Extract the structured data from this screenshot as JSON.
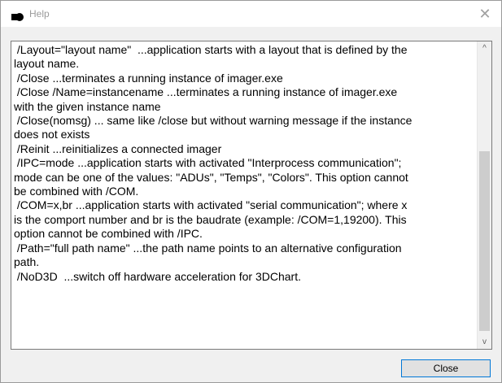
{
  "window": {
    "title": "Help",
    "title_icon": "app-icon",
    "close_glyph": "✕"
  },
  "help_text": {
    "lines": [
      " /Layout=\"layout name\"  ...application starts with a layout that is defined by the",
      "layout name.",
      " /Close ...terminates a running instance of imager.exe",
      " /Close /Name=instancename ...terminates a running instance of imager.exe",
      "with the given instance name",
      " /Close(nomsg) ... same like /close but without warning message if the instance",
      "does not exists",
      " /Reinit ...reinitializes a connected imager",
      " /IPC=mode ...application starts with activated \"Interprocess communication\";",
      "mode can be one of the values: \"ADUs\", \"Temps\", \"Colors\". This option cannot",
      "be combined with /COM.",
      " /COM=x,br ...application starts with activated \"serial communication\"; where x",
      "is the comport number and br is the baudrate (example: /COM=1,19200). This",
      "option cannot be combined with /IPC.",
      " /Path=\"full path name\" ...the path name points to an alternative configuration",
      "path.",
      " /NoD3D  ...switch off hardware acceleration for 3DChart."
    ]
  },
  "scrollbar": {
    "up_glyph": "^",
    "down_glyph": "v"
  },
  "buttons": {
    "close_label": "Close"
  }
}
